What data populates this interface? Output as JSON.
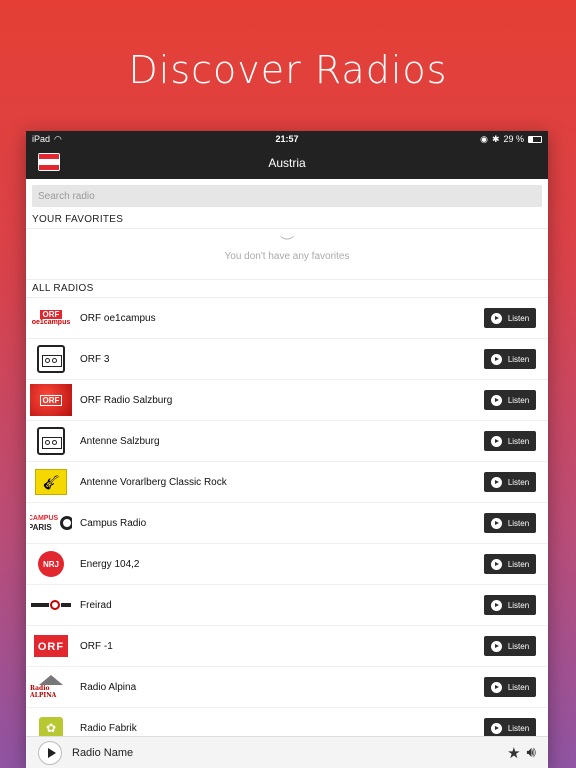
{
  "headline": "Discover Radios",
  "statusbar": {
    "carrier": "iPad",
    "time": "21:57",
    "battery": "29 %"
  },
  "navbar": {
    "title": "Austria",
    "flag_colors": [
      "#e2272f",
      "#ffffff",
      "#e2272f"
    ]
  },
  "search": {
    "placeholder": "Search radio"
  },
  "favorites": {
    "header": "YOUR FAVORITES",
    "empty_icon": "︶",
    "empty_text": "You don't have any favorites"
  },
  "all_radios": {
    "header": "ALL RADIOS",
    "listen_label": "Listen",
    "items": [
      {
        "name": "ORF oe1campus",
        "logo": "orf-oe1campus-logo"
      },
      {
        "name": "ORF 3",
        "logo": "radio-placeholder-icon"
      },
      {
        "name": "ORF Radio Salzburg",
        "logo": "orf-salzburg-logo"
      },
      {
        "name": "Antenne Salzburg",
        "logo": "radio-placeholder-icon"
      },
      {
        "name": "Antenne Vorarlberg Classic Rock",
        "logo": "antenne-vorarlberg-logo"
      },
      {
        "name": "Campus Radio",
        "logo": "campus-paris-logo"
      },
      {
        "name": "Energy 104,2",
        "logo": "energy-logo"
      },
      {
        "name": "Freirad",
        "logo": "freirad-logo"
      },
      {
        "name": "ORF -1",
        "logo": "orf-logo"
      },
      {
        "name": "Radio Alpina",
        "logo": "radio-alpina-logo"
      },
      {
        "name": "Radio Fabrik",
        "logo": "radio-fabrik-logo"
      }
    ]
  },
  "player": {
    "name": "Radio Name"
  },
  "logo_texts": {
    "orf": "ORF",
    "oe1campus": "oe1campus",
    "campus": "CAMPUS",
    "paris": "PARIS",
    "nrj": "NRJ",
    "alpina": "Radio ALPINA"
  },
  "colors": {
    "accent_red": "#e2272f",
    "dark_bar": "#222222",
    "button": "#2b2b2b"
  }
}
